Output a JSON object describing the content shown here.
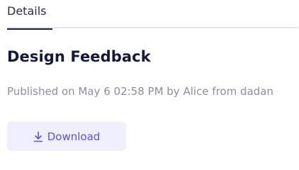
{
  "tabs": [
    {
      "label": "Details",
      "active": true
    }
  ],
  "post": {
    "title": "Design Feedback",
    "meta": "Published on May 6 02:58 PM by Alice from dadan"
  },
  "actions": {
    "download_label": "Download",
    "download_icon": "download-icon"
  },
  "colors": {
    "accent": "#5b52e0",
    "button_bg": "#efeefd",
    "title": "#14183a",
    "meta_text": "#8b8f9e"
  }
}
